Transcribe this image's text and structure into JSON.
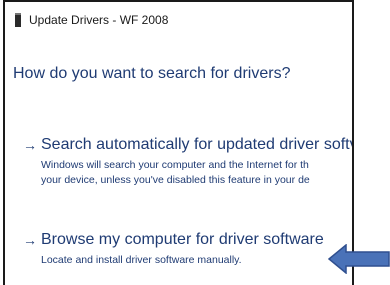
{
  "window": {
    "title": "Update Drivers - WF 2008"
  },
  "wizard": {
    "question": "How do you want to search for drivers?",
    "options": [
      {
        "arrow": "→",
        "label": "Search automatically for updated driver softv",
        "description_lines": [
          "Windows will search your computer and the Internet for th",
          "your device, unless you've disabled this feature in your de"
        ]
      },
      {
        "arrow": "→",
        "label": "Browse my computer for driver software",
        "description_lines": [
          "Locate and install driver software manually."
        ]
      }
    ]
  },
  "colors": {
    "link_blue": "#1f3b73",
    "pointer_blue": "#4a72b8",
    "pointer_outline": "#2f4f8f"
  },
  "icons": {
    "device": "device-icon",
    "arrow": "right-arrow-icon",
    "callout": "left-arrow-callout-icon"
  }
}
